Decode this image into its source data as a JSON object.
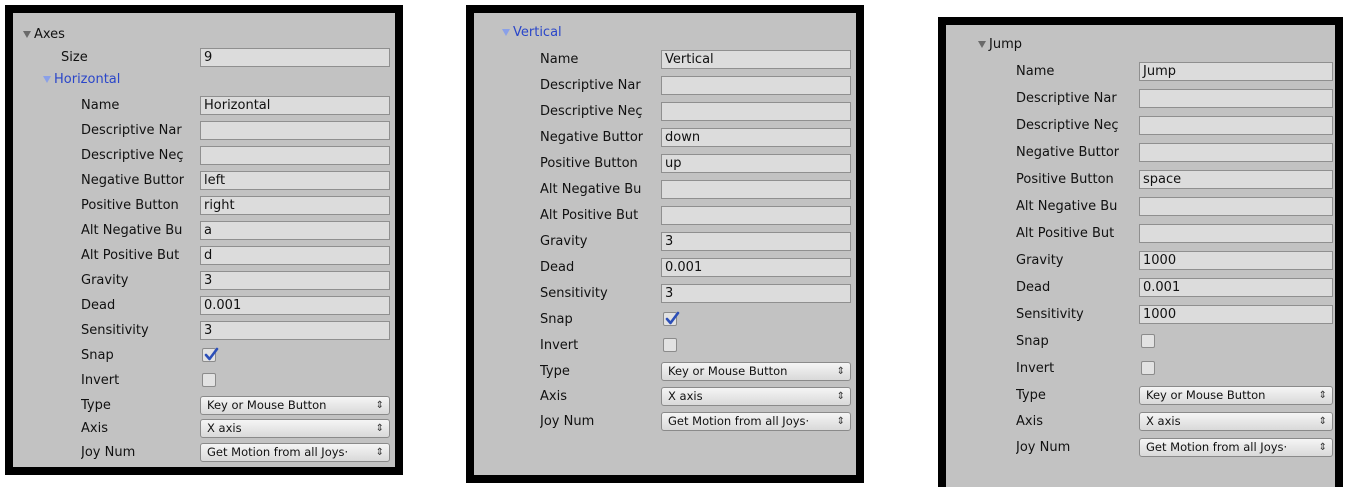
{
  "panels": [
    {
      "header": "Axes",
      "size_label": "Size",
      "size_value": "9",
      "section": "Horizontal",
      "labels": {
        "name": "Name",
        "desc_name": "Descriptive Nar",
        "desc_neg": "Descriptive Neç",
        "neg_button": "Negative Buttor",
        "pos_button": "Positive Button",
        "alt_neg": "Alt Negative Bu",
        "alt_pos": "Alt Positive But",
        "gravity": "Gravity",
        "dead": "Dead",
        "sensitivity": "Sensitivity",
        "snap": "Snap",
        "invert": "Invert",
        "type": "Type",
        "axis": "Axis",
        "joy_num": "Joy Num"
      },
      "values": {
        "name": "Horizontal",
        "desc_name": "",
        "desc_neg": "",
        "neg_button": "left",
        "pos_button": "right",
        "alt_neg": "a",
        "alt_pos": "d",
        "gravity": "3",
        "dead": "0.001",
        "sensitivity": "3",
        "snap": true,
        "invert": false,
        "type": "Key or Mouse Button",
        "axis": "X axis",
        "joy_num": "Get Motion from all Joys·"
      }
    },
    {
      "section": "Vertical",
      "labels": {
        "name": "Name",
        "desc_name": "Descriptive Nar",
        "desc_neg": "Descriptive Neç",
        "neg_button": "Negative Buttor",
        "pos_button": "Positive Button",
        "alt_neg": "Alt Negative Bu",
        "alt_pos": "Alt Positive But",
        "gravity": "Gravity",
        "dead": "Dead",
        "sensitivity": "Sensitivity",
        "snap": "Snap",
        "invert": "Invert",
        "type": "Type",
        "axis": "Axis",
        "joy_num": "Joy Num"
      },
      "values": {
        "name": "Vertical",
        "desc_name": "",
        "desc_neg": "",
        "neg_button": "down",
        "pos_button": "up",
        "alt_neg": "",
        "alt_pos": "",
        "gravity": "3",
        "dead": "0.001",
        "sensitivity": "3",
        "snap": true,
        "invert": false,
        "type": "Key or Mouse Button",
        "axis": "X axis",
        "joy_num": "Get Motion from all Joys·"
      }
    },
    {
      "section": "Jump",
      "labels": {
        "name": "Name",
        "desc_name": "Descriptive Nar",
        "desc_neg": "Descriptive Neç",
        "neg_button": "Negative Buttor",
        "pos_button": "Positive Button",
        "alt_neg": "Alt Negative Bu",
        "alt_pos": "Alt Positive But",
        "gravity": "Gravity",
        "dead": "Dead",
        "sensitivity": "Sensitivity",
        "snap": "Snap",
        "invert": "Invert",
        "type": "Type",
        "axis": "Axis",
        "joy_num": "Joy Num"
      },
      "values": {
        "name": "Jump",
        "desc_name": "",
        "desc_neg": "",
        "neg_button": "",
        "pos_button": "space",
        "alt_neg": "",
        "alt_pos": "",
        "gravity": "1000",
        "dead": "0.001",
        "sensitivity": "1000",
        "snap": false,
        "invert": false,
        "type": "Key or Mouse Button",
        "axis": "X axis",
        "joy_num": "Get Motion from all Joys·"
      }
    }
  ],
  "icons": {
    "fold": "triangle-down-icon",
    "check": "checkmark-icon",
    "dropdown": "updown-arrows-icon"
  },
  "colors": {
    "panel_bg": "#c2c2c2",
    "foldout_blue": "#2a46c9",
    "frame": "#000000"
  }
}
